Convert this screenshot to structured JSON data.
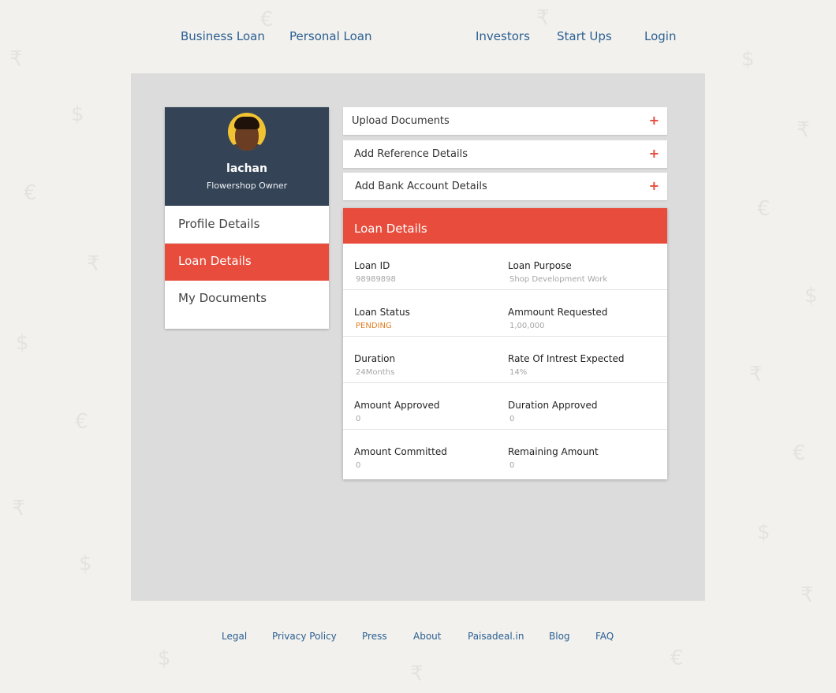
{
  "nav": {
    "items": [
      "Business Loan",
      "Personal Loan",
      "Investors",
      "Start Ups",
      "Login"
    ]
  },
  "profile": {
    "name": "lachan",
    "role": "Flowershop Owner",
    "menu": [
      "Profile Details",
      "Loan Details",
      "My Documents"
    ],
    "active_menu": "Loan Details"
  },
  "accordions": [
    "Upload Documents",
    "Add Reference Details",
    "Add Bank Account Details"
  ],
  "loan": {
    "title": "Loan Details",
    "rows": [
      [
        {
          "label": "Loan ID",
          "value": "98989898"
        },
        {
          "label": "Loan Purpose",
          "value": "Shop Development Work"
        }
      ],
      [
        {
          "label": "Loan Status",
          "value": "PENDING"
        },
        {
          "label": "Ammount Requested",
          "value": "1,00,000"
        }
      ],
      [
        {
          "label": "Duration",
          "value": "24Months"
        },
        {
          "label": "Rate Of Intrest Expected",
          "value": "14%"
        }
      ],
      [
        {
          "label": "Amount Approved",
          "value": "0"
        },
        {
          "label": "Duration Approved",
          "value": "0"
        }
      ],
      [
        {
          "label": "Amount Committed",
          "value": "0"
        },
        {
          "label": "Remaining Amount",
          "value": "0"
        }
      ]
    ]
  },
  "footer": {
    "links": [
      "Legal",
      "Privacy Policy",
      "Press",
      "About",
      "Paisadeal.in",
      "Blog",
      "FAQ"
    ]
  },
  "colors": {
    "accent": "#e74c3c",
    "profile_header": "#344456",
    "link": "#2b5f92",
    "pending": "#e67e22"
  },
  "icons": {
    "accordion_toggle": "plus-icon",
    "background_pattern": "currency-symbols-pattern"
  }
}
